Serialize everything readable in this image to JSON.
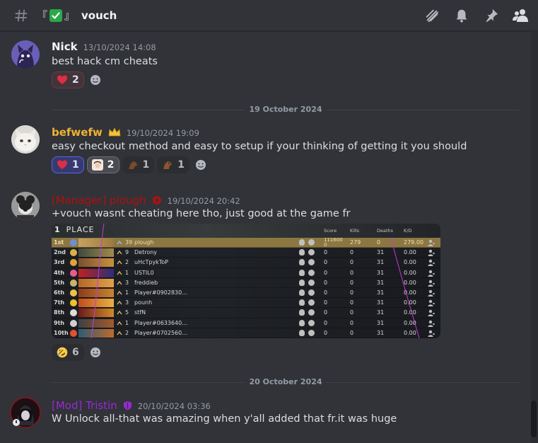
{
  "channel": {
    "bracket_open": "『",
    "bracket_close": "』",
    "name": "vouch",
    "icons": [
      "threads-icon",
      "bell-icon",
      "pin-icon",
      "members-icon"
    ]
  },
  "colors": {
    "background": "#313338",
    "timestamp": "#949ba4",
    "befwefw": "#f0b232",
    "manager": "#b01010",
    "mod": "#9b28d6",
    "reaction_me": "#5865f2"
  },
  "messages": [
    {
      "author": "Nick",
      "timestamp": "13/10/2024 14:08",
      "content": "best hack cm cheats",
      "reactions": [
        {
          "emoji": "heart",
          "count": "2"
        }
      ]
    },
    {
      "divider": "19 October 2024"
    },
    {
      "author": "befwefw",
      "author_badge": "👑",
      "timestamp": "19/10/2024 19:09",
      "content": "easy checkout method and easy to setup if your thinking of getting it you should",
      "reactions": [
        {
          "emoji": "heart",
          "count": "1"
        },
        {
          "emoji": "person-face",
          "count": "2"
        },
        {
          "emoji": "horse-1",
          "count": "1"
        },
        {
          "emoji": "horse-2",
          "count": "1"
        }
      ]
    },
    {
      "author": "[Manager] plough",
      "timestamp": "19/10/2024 20:42",
      "content": "+vouch wasnt cheating here tho, just good at the game fr",
      "reactions": [
        {
          "emoji": "rofl",
          "count": "6"
        }
      ]
    },
    {
      "divider": "20 October 2024"
    },
    {
      "author": "[Mod] Tristin",
      "timestamp": "20/10/2024 03:36",
      "content": "W Unlock all-that was amazing when y'all added that fr.it was huge"
    }
  ],
  "scoreboard": {
    "place_num": "1",
    "place_label": "PLACE",
    "headers": {
      "score": "Score",
      "kills": "Kills",
      "deaths": "Deaths",
      "kd": "K/D"
    },
    "rows": [
      {
        "rank": "1st",
        "level": "39",
        "name": "plough",
        "score": "111600\n0",
        "kills": "279",
        "deaths": "0",
        "kd": "279.00"
      },
      {
        "rank": "2nd",
        "level": "9",
        "name": "Detrony",
        "score": "0",
        "kills": "0",
        "deaths": "31",
        "kd": "0.00"
      },
      {
        "rank": "3rd",
        "level": "2",
        "name": "uHcTpykToP",
        "score": "0",
        "kills": "0",
        "deaths": "31",
        "kd": "0.00"
      },
      {
        "rank": "4th",
        "level": "1",
        "name": "USTIL0",
        "score": "0",
        "kills": "0",
        "deaths": "31",
        "kd": "0.00"
      },
      {
        "rank": "5th",
        "level": "3",
        "name": "freddieb",
        "score": "0",
        "kills": "0",
        "deaths": "31",
        "kd": "0.00"
      },
      {
        "rank": "6th",
        "level": "1",
        "name": "Player#0902830...",
        "score": "0",
        "kills": "0",
        "deaths": "31",
        "kd": "0.00"
      },
      {
        "rank": "7th",
        "level": "3",
        "name": "pounh",
        "score": "0",
        "kills": "0",
        "deaths": "31",
        "kd": "0.00"
      },
      {
        "rank": "8th",
        "level": "5",
        "name": "stfN",
        "score": "0",
        "kills": "0",
        "deaths": "31",
        "kd": "0.00"
      },
      {
        "rank": "9th",
        "level": "1",
        "name": "Player#0633640...",
        "score": "0",
        "kills": "0",
        "deaths": "31",
        "kd": "0.00"
      },
      {
        "rank": "10th",
        "level": "2",
        "name": "Player#0702560...",
        "score": "0",
        "kills": "0",
        "deaths": "31",
        "kd": "0.00"
      }
    ]
  }
}
